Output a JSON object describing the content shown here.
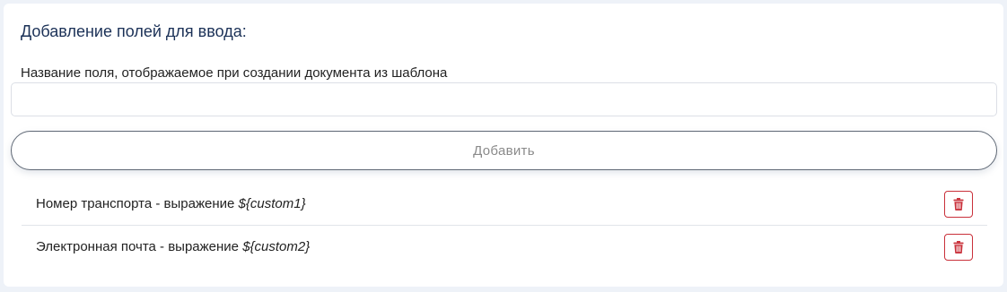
{
  "form": {
    "title": "Добавление полей для ввода:",
    "field_label": "Название поля, отображаемое при создании документа из шаблона",
    "input_value": "",
    "input_placeholder": "",
    "add_button_label": "Добавить"
  },
  "fields": [
    {
      "name": "Номер транспорта",
      "separator": " - выражение ",
      "expression": "${custom1}",
      "delete_icon": "trash-icon"
    },
    {
      "name": "Электронная почта",
      "separator": " - выражение ",
      "expression": "${custom2}",
      "delete_icon": "trash-icon"
    }
  ],
  "colors": {
    "title": "#1b3157",
    "delete_accent": "#c9303a",
    "page_background": "#eef2f8"
  }
}
